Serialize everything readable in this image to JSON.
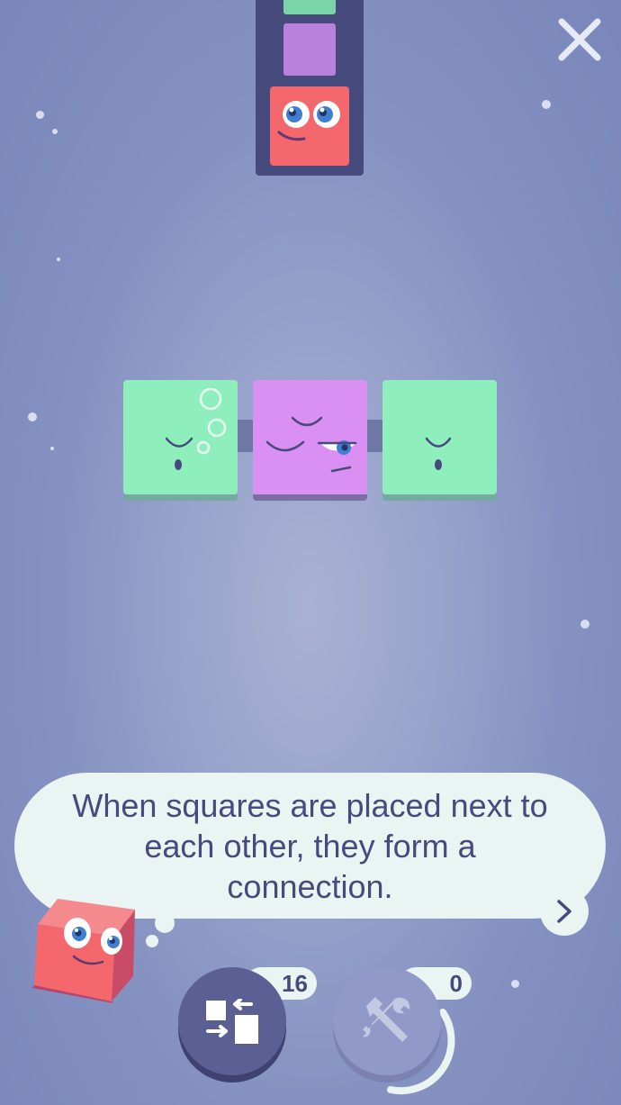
{
  "game": {
    "queue": {
      "pieces": [
        "green-square",
        "purple-square",
        "red-square"
      ]
    },
    "board": {
      "tiles": [
        {
          "color": "#8fefbc",
          "mood": "sleepy-bubbles"
        },
        {
          "color": "#da8ff2",
          "mood": "sleepy-one-eye-open"
        },
        {
          "color": "#8fefbc",
          "mood": "sleepy"
        }
      ]
    },
    "tutorial": {
      "message": "When squares are placed next to each other, they form a connection.",
      "next_icon": "chevron-right-icon",
      "mascot": "red-cube-mascot"
    },
    "powerups": {
      "swap": {
        "count": "16",
        "icon": "swap-icon"
      },
      "tools": {
        "count": "0",
        "icon": "tools-icon"
      }
    },
    "colors": {
      "green": "#8fefbc",
      "purple": "#da8ff2",
      "red": "#f3676d",
      "navy": "#474a7d",
      "bubble": "#eaf4f2"
    }
  }
}
